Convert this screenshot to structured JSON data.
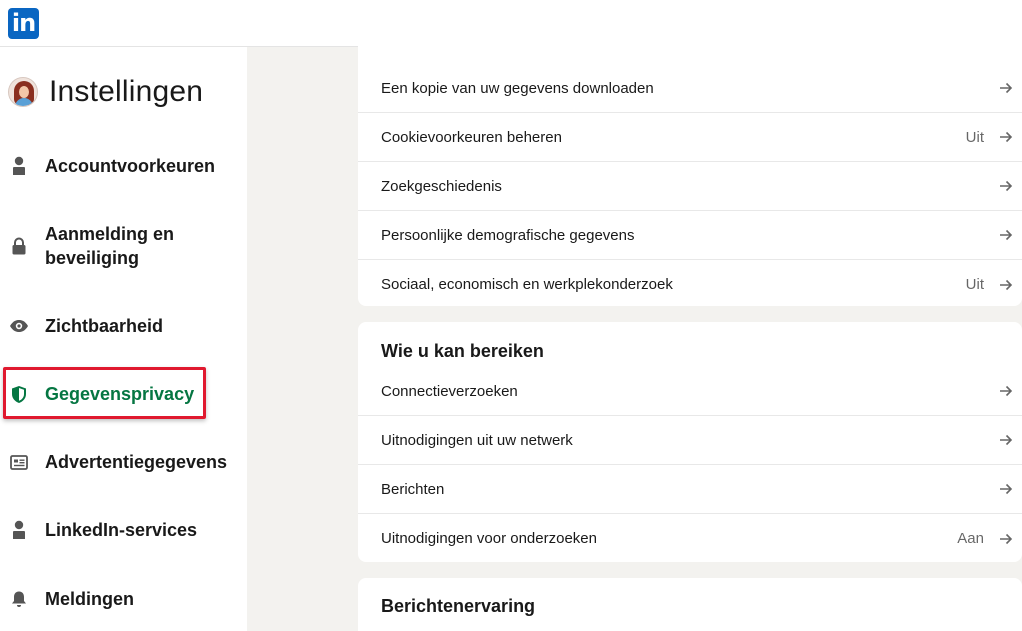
{
  "brand": {
    "logo_text": "in",
    "color": "#0a66c2"
  },
  "sidebar": {
    "title": "Instellingen",
    "items": [
      {
        "label": "Accountvoorkeuren",
        "icon": "person-icon"
      },
      {
        "label": "Aanmelding en beveiliging",
        "icon": "lock-icon"
      },
      {
        "label": "Zichtbaarheid",
        "icon": "eye-icon"
      },
      {
        "label": "Gegevensprivacy",
        "icon": "shield-icon",
        "active": true
      },
      {
        "label": "Advertentiegegevens",
        "icon": "newspaper-icon"
      },
      {
        "label": "LinkedIn-services",
        "icon": "person-icon"
      },
      {
        "label": "Meldingen",
        "icon": "bell-icon"
      }
    ],
    "active_color": "#057642",
    "highlight_color": "#e0192f"
  },
  "main": {
    "card1": {
      "rows": [
        {
          "label": "Een kopie van uw gegevens downloaden",
          "value": ""
        },
        {
          "label": "Cookievoorkeuren beheren",
          "value": "Uit"
        },
        {
          "label": "Zoekgeschiedenis",
          "value": ""
        },
        {
          "label": "Persoonlijke demografische gegevens",
          "value": ""
        },
        {
          "label": "Sociaal, economisch en werkplekonderzoek",
          "value": "Uit"
        }
      ]
    },
    "card2": {
      "title": "Wie u kan bereiken",
      "rows": [
        {
          "label": "Connectieverzoeken",
          "value": ""
        },
        {
          "label": "Uitnodigingen uit uw netwerk",
          "value": ""
        },
        {
          "label": "Berichten",
          "value": ""
        },
        {
          "label": "Uitnodigingen voor onderzoeken",
          "value": "Aan"
        }
      ]
    },
    "card3": {
      "title": "Berichtenervaring"
    }
  }
}
